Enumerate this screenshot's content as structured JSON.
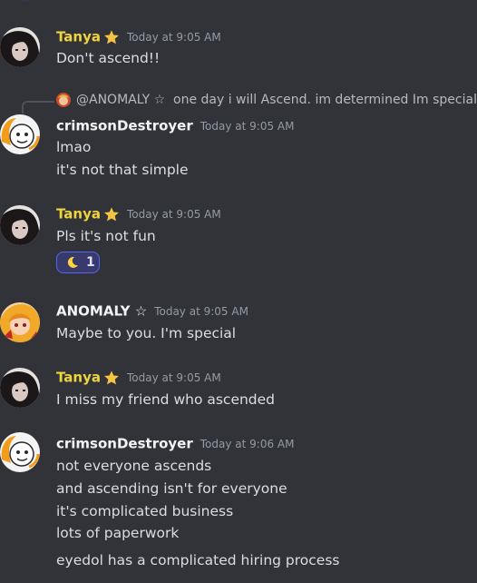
{
  "reply": {
    "name": "@ANOMALY ☆",
    "text": "one day i will Ascend. im determined Im special"
  },
  "messages": [
    {
      "author": "Tanya",
      "time": "Today at 9:05 AM",
      "lines": [
        "Don't ascend!!"
      ]
    },
    {
      "author": "crimsonDestroyer",
      "time": "Today at 9:05 AM",
      "lines": [
        "lmao",
        "it's not that simple"
      ]
    },
    {
      "author": "Tanya",
      "time": "Today at 9:05 AM",
      "lines": [
        "Pls it's not fun"
      ],
      "reaction": {
        "emoji": "moon-icon",
        "count": "1"
      }
    },
    {
      "author": "ANOMALY ☆",
      "time": "Today at 9:05 AM",
      "lines": [
        "Maybe to you. I'm special"
      ]
    },
    {
      "author": "Tanya",
      "time": "Today at 9:05 AM",
      "lines": [
        "I miss my friend who ascended"
      ]
    },
    {
      "author": "crimsonDestroyer",
      "time": "Today at 9:06 AM",
      "lines": [
        "not everyone ascends",
        "and ascending isn't for everyone",
        "it's complicated business",
        "lots of paperwork",
        "eyedol has a complicated hiring process"
      ]
    }
  ],
  "colors": {
    "background": "#313338",
    "tanya_name": "#f0d43d",
    "text": "#dbdee1",
    "timestamp": "#949ba4",
    "reaction_border": "#5865f2"
  }
}
